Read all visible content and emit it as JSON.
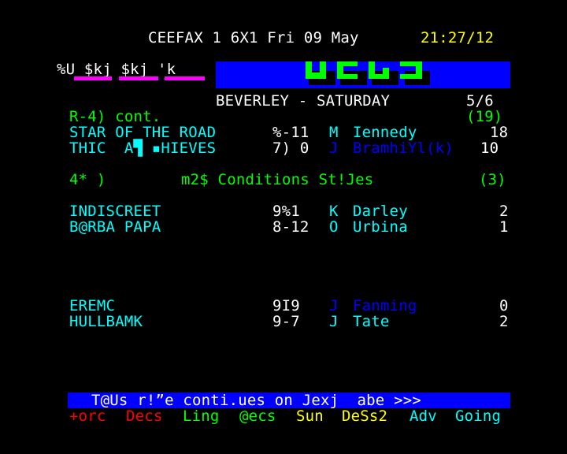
{
  "header": {
    "service": "CEEFAX 1 6X1 Fri 09 May",
    "time": "21:27/12"
  },
  "masthead": {
    "left_text": "%U $kj $kj 'k",
    "title": "BEVERLEY - SATURDAY",
    "page": "5/6"
  },
  "races": [
    {
      "heading": "R-4) cont.",
      "runners_count": "(19)",
      "runners": [
        {
          "horse": "STAR OF THE ROAD",
          "odds": "%-11",
          "jockey_code": "M",
          "jockey": "Iennedy",
          "position": "18"
        },
        {
          "horse": "THIC  A▜ ▪HIEVES",
          "odds": "7) 0",
          "jockey_code": "J",
          "jockey": "BramhiYl(k)",
          "position": "10"
        }
      ]
    },
    {
      "heading_left": "4* )",
      "heading": "m2$ Conditions St!Jes",
      "runners_count": "(3)",
      "runners": [
        {
          "horse": "INDISCREET",
          "odds": "9%1",
          "jockey_code": "K",
          "jockey": "Darley",
          "position": "2"
        },
        {
          "horse": "B@RBA PAPA",
          "odds": "8-12",
          "jockey_code": "O",
          "jockey": "Urbina",
          "position": "1"
        },
        {
          "horse": "EREMC",
          "odds": "9I9",
          "jockey_code": "J",
          "jockey": "Fanming",
          "position": "0"
        },
        {
          "horse": "HULLBAMK",
          "odds": "9-7",
          "jockey_code": "J",
          "jockey": "Tate",
          "position": "2"
        }
      ]
    }
  ],
  "continue_banner": "T@Us r!”e conti.ues on Jexj  abe >>>",
  "fastext": [
    {
      "label": "+orc",
      "color": "#ff0000"
    },
    {
      "label": "Decs",
      "color": "#ff0000"
    },
    {
      "label": "Ling",
      "color": "#00ff00"
    },
    {
      "label": "@ecs",
      "color": "#00ff00"
    },
    {
      "label": "Sun",
      "color": "#ffff00"
    },
    {
      "label": "DeSs2",
      "color": "#ffff00"
    },
    {
      "label": "Adv",
      "color": "#00ffff"
    },
    {
      "label": "Going",
      "color": "#00ffff"
    }
  ],
  "colors": {
    "background": "#000000",
    "banner": "#0000ff",
    "accent_magenta": "#ff00ff",
    "graphics_green": "#00ff00",
    "horse_text": "#00ffff",
    "jockey_blue": "#0000ff"
  }
}
